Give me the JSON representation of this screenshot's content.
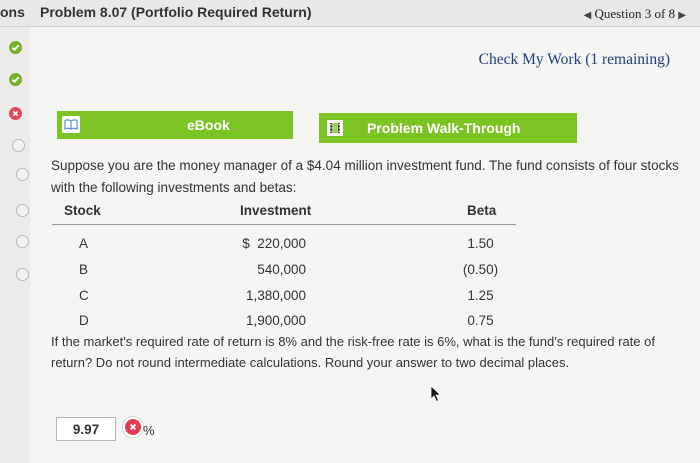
{
  "topbar": {
    "left_fragment": "ons",
    "problem_title": "Problem 8.07 (Portfolio Required Return)",
    "question_nav": "Question 3 of 8"
  },
  "check_work": "Check My Work (1 remaining)",
  "buttons": {
    "ebook": "eBook",
    "walkthrough": "Problem Walk-Through"
  },
  "question_text": "Suppose you are the money manager of a $4.04 million investment fund. The fund consists of four stocks with the following investments and betas:",
  "table": {
    "headers": [
      "Stock",
      "Investment",
      "Beta"
    ],
    "rows": [
      {
        "stock": "A",
        "investment": "$  220,000",
        "beta": "1.50"
      },
      {
        "stock": "B",
        "investment": "540,000",
        "beta": "(0.50)"
      },
      {
        "stock": "C",
        "investment": "1,380,000",
        "beta": "1.25"
      },
      {
        "stock": "D",
        "investment": "1,900,000",
        "beta": "0.75"
      }
    ]
  },
  "prompt_text": "If the market's required rate of return is 8% and the risk-free rate is 6%, what is the fund's required rate of return? Do not round intermediate calculations. Round your answer to two decimal places.",
  "answer": {
    "value": "9.97",
    "unit": "%"
  },
  "colors": {
    "accent_green": "#7cc423",
    "error_red": "#e03b50",
    "link_blue": "#1d3f7a"
  }
}
